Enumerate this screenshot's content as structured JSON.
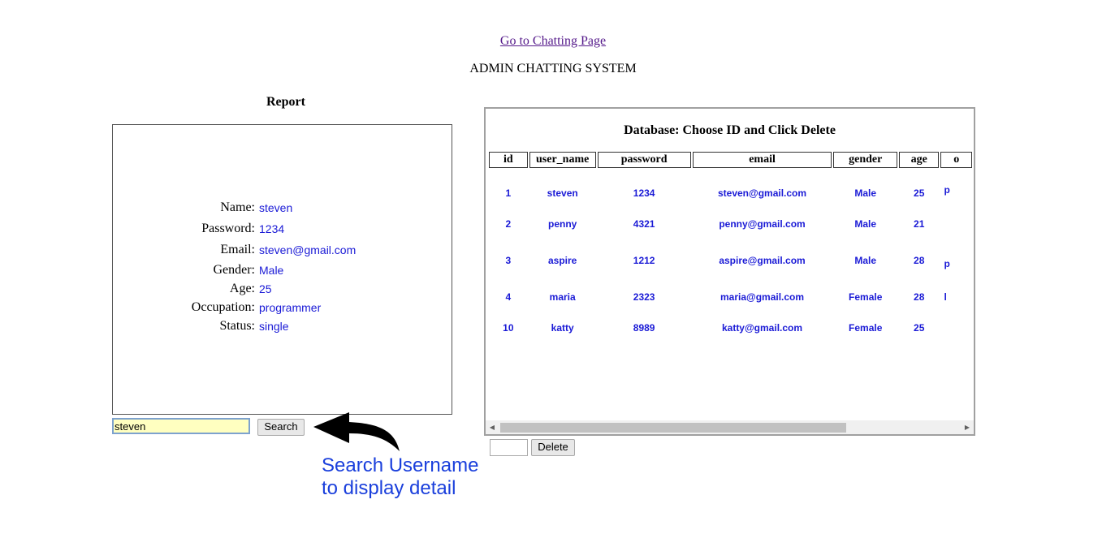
{
  "nav": {
    "chat_link": "Go to Chatting Page"
  },
  "page_title": "ADMIN CHATTING SYSTEM",
  "report": {
    "heading": "Report",
    "fields": [
      {
        "label": "Name:",
        "value": "steven"
      },
      {
        "label": "Password:",
        "value": "1234"
      },
      {
        "label": "Email:",
        "value": "steven@gmail.com"
      },
      {
        "label": "Gender:",
        "value": "Male"
      },
      {
        "label": "Age:",
        "value": "25"
      },
      {
        "label": "Occupation:",
        "value": "programmer"
      },
      {
        "label": "Status:",
        "value": "single"
      }
    ]
  },
  "search": {
    "value": "steven",
    "button_label": "Search"
  },
  "database": {
    "heading": "Database: Choose ID and Click Delete",
    "columns": [
      "id",
      "user_name",
      "password",
      "email",
      "gender",
      "age",
      "o"
    ],
    "rows": [
      [
        "1",
        "steven",
        "1234",
        "steven@gmail.com",
        "Male",
        "25",
        "p"
      ],
      [
        "2",
        "penny",
        "4321",
        "penny@gmail.com",
        "Male",
        "21",
        ""
      ],
      [
        "3",
        "aspire",
        "1212",
        "aspire@gmail.com",
        "Male",
        "28",
        "p"
      ],
      [
        "4",
        "maria",
        "2323",
        "maria@gmail.com",
        "Female",
        "28",
        "l"
      ],
      [
        "10",
        "katty",
        "8989",
        "katty@gmail.com",
        "Female",
        "25",
        ""
      ]
    ],
    "scrollbar": {
      "left_arrow": "◀",
      "right_arrow": "▶"
    }
  },
  "delete": {
    "value": "",
    "button_label": "Delete"
  },
  "annotation": {
    "line1": "Search Username",
    "line2": "to display detail"
  },
  "colors": {
    "value_text": "#1a1ad6",
    "annotation_text": "#1a3fdc",
    "visited_link": "#551a8b",
    "search_bg": "#ffffc0"
  }
}
